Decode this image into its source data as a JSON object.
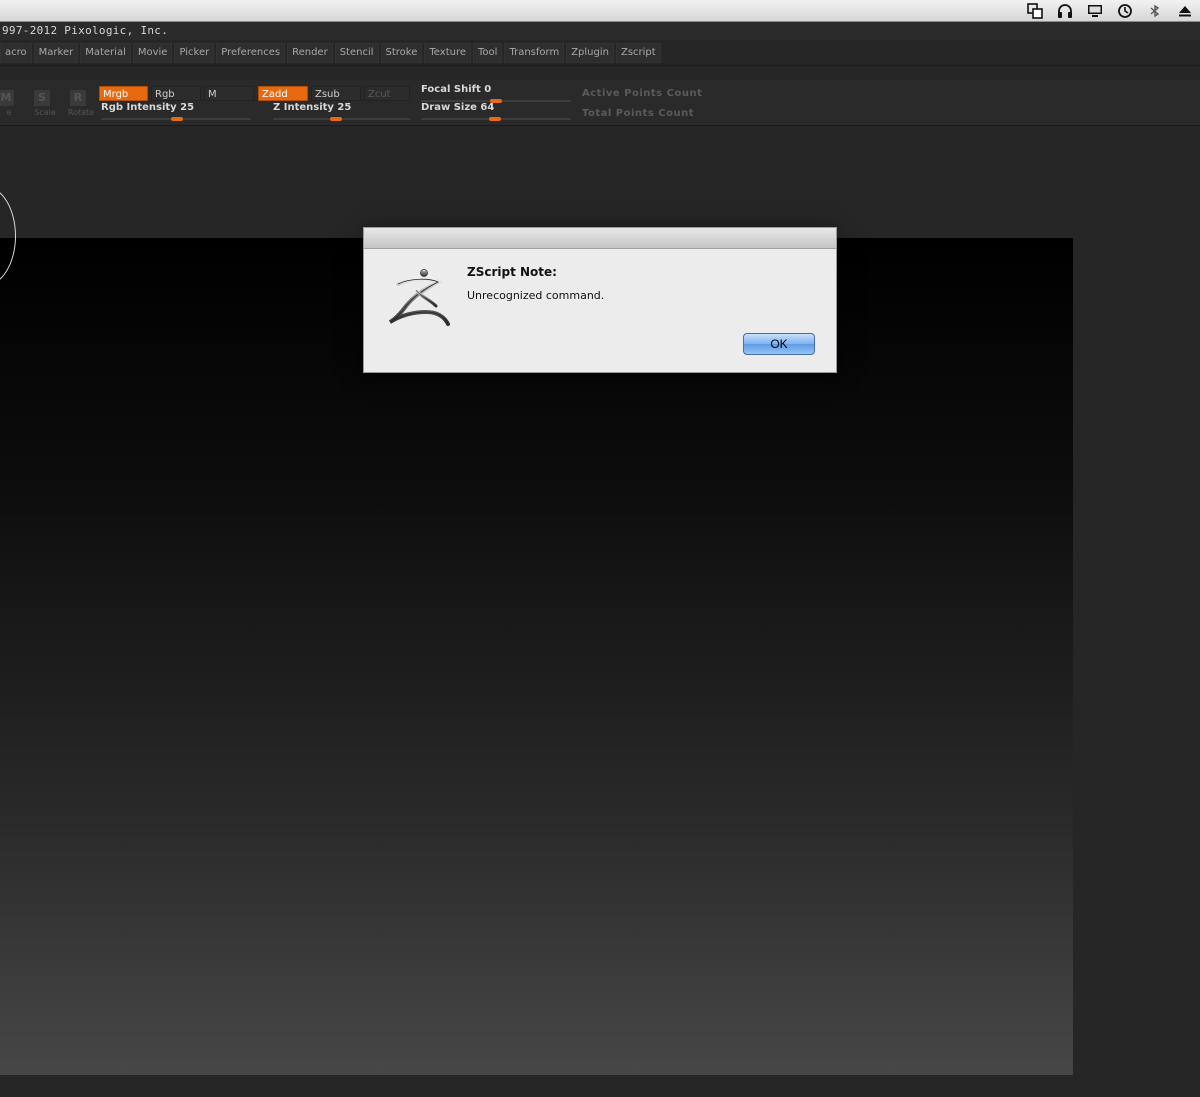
{
  "app": {
    "copyright": "997-2012 Pixologic, Inc."
  },
  "menubar_icons": [
    "windows-icon",
    "headphones-icon",
    "display-icon",
    "time-machine-icon",
    "bluetooth-icon",
    "eject-icon"
  ],
  "menus": [
    "acro",
    "Marker",
    "Material",
    "Movie",
    "Picker",
    "Preferences",
    "Render",
    "Stencil",
    "Stroke",
    "Texture",
    "Tool",
    "Transform",
    "Zplugin",
    "Zscript"
  ],
  "toolbar": {
    "icons": [
      {
        "glyph": "M",
        "label": "e"
      },
      {
        "glyph": "S",
        "label": "Scale"
      },
      {
        "glyph": "R",
        "label": "Rotate"
      }
    ],
    "mrgb": "Mrgb",
    "rgb": "Rgb",
    "m": "M",
    "zadd": "Zadd",
    "zsub": "Zsub",
    "zcut": "Zcut",
    "rgb_intensity": {
      "label": "Rgb Intensity 25",
      "value": 25
    },
    "z_intensity": {
      "label": "Z Intensity 25",
      "value": 25
    },
    "focal_shift": {
      "label": "Focal Shift 0",
      "value": 0
    },
    "draw_size": {
      "label": "Draw Size 64",
      "value": 64
    },
    "active_points": "Active Points Count",
    "total_points": "Total Points Count"
  },
  "dialog": {
    "title": "ZScript Note:",
    "message": "Unrecognized command.",
    "ok_label": "OK"
  }
}
